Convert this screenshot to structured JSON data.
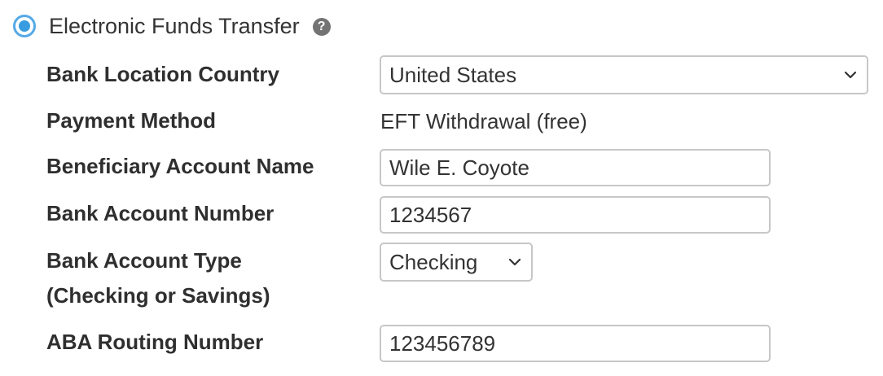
{
  "payment_option": {
    "label": "Electronic Funds Transfer",
    "selected": true,
    "help_icon": "question-circle-icon",
    "help_glyph": "?"
  },
  "form": {
    "bank_location_country": {
      "label": "Bank Location Country",
      "value": "United States"
    },
    "payment_method": {
      "label": "Payment Method",
      "value": "EFT Withdrawal (free)"
    },
    "beneficiary_account_name": {
      "label": "Beneficiary Account Name",
      "value": "Wile E. Coyote"
    },
    "bank_account_number": {
      "label": "Bank Account Number",
      "value": "1234567"
    },
    "bank_account_type": {
      "label_line1": "Bank Account Type",
      "label_line2": "(Checking or Savings)",
      "value": "Checking"
    },
    "aba_routing_number": {
      "label": "ABA Routing Number",
      "value": "123456789"
    }
  },
  "colors": {
    "radio_accent": "#3a9ce0",
    "border": "#c7c7c7",
    "label_text": "#2f2f2f"
  }
}
